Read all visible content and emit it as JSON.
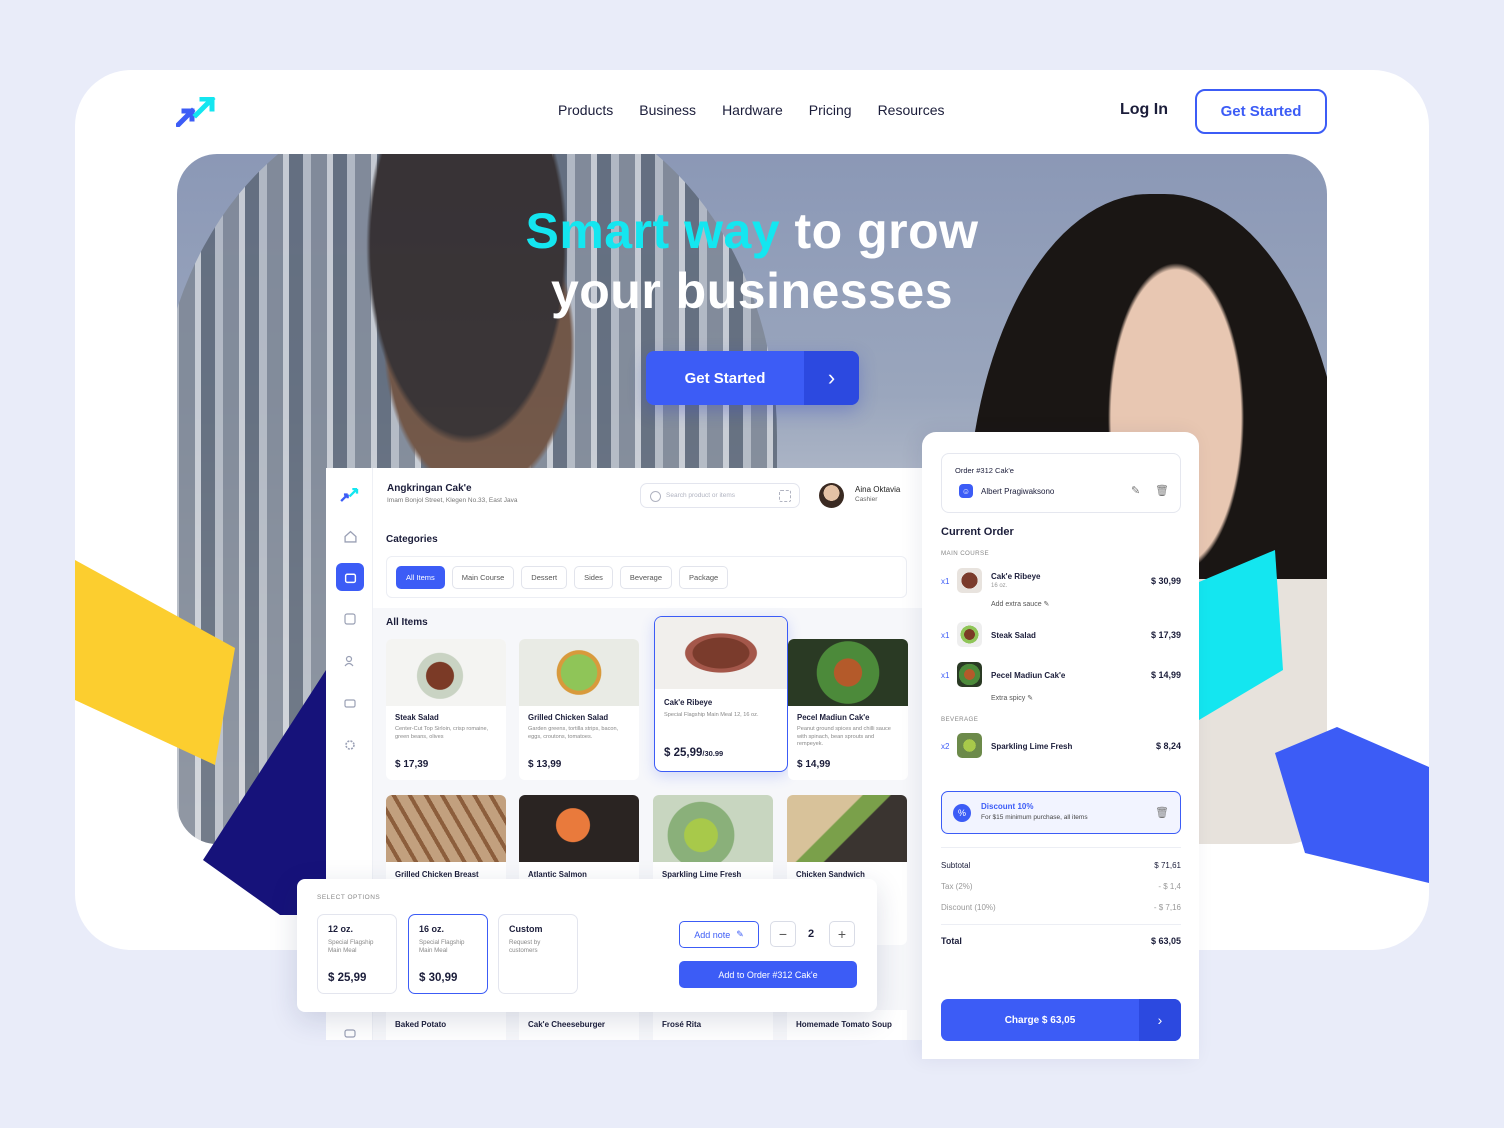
{
  "nav": {
    "links": [
      "Products",
      "Business",
      "Hardware",
      "Pricing",
      "Resources"
    ],
    "login": "Log In",
    "get_started": "Get Started"
  },
  "hero": {
    "accent": "Smart way",
    "line1_rest": " to grow",
    "line2": "your businesses",
    "cta": "Get Started",
    "cta_arrow": "›"
  },
  "colors": {
    "primary": "#3c5cf6",
    "accent": "#14e6f0",
    "yellow": "#fcce2f",
    "navy": "#16127a"
  },
  "pos": {
    "store_name": "Angkringan Cak'e",
    "address": "Imam Bonjol Street, Klegen No.33, East Java",
    "search_placeholder": "Search product or items",
    "user_name": "Aina Oktavia",
    "user_role": "Cashier",
    "categories_title": "Categories",
    "categories": [
      "All Items",
      "Main Course",
      "Dessert",
      "Sides",
      "Beverage",
      "Package"
    ],
    "all_items_title": "All Items",
    "items": [
      {
        "name": "Steak Salad",
        "desc": "Center-Cut Top Sirloin, crisp romaine, green beans, olives",
        "price": "$ 17,39"
      },
      {
        "name": "Grilled Chicken Salad",
        "desc": "Garden greens, tortilla strips, bacon, eggs, croutons, tomatoes.",
        "price": "$ 13,99"
      },
      {
        "name": "Cak'e Ribeye",
        "desc": "Special Flagship Main Meal 12, 16 oz.",
        "price": "$ 25,99",
        "price_alt": "/30.99"
      },
      {
        "name": "Pecel Madiun Cak'e",
        "desc": "Peanut ground spices and chilli sauce with spinach, bean sprouts and rempeyek.",
        "price": "$ 14,99"
      }
    ],
    "items_row2": [
      "Grilled Chicken Breast",
      "Atlantic Salmon",
      "Sparkling Lime Fresh",
      "Chicken Sandwich"
    ],
    "items_row3": [
      "Baked Potato",
      "Cak'e Cheeseburger",
      "Frosé Rita",
      "Homemade Tomato Soup"
    ]
  },
  "options": {
    "label": "SELECT OPTIONS",
    "list": [
      {
        "title": "12 oz.",
        "desc": "Special Flagship Main Meal",
        "price": "$ 25,99"
      },
      {
        "title": "16 oz.",
        "desc": "Special Flagship Main Meal",
        "price": "$ 30,99"
      },
      {
        "title": "Custom",
        "desc": "Request by customers",
        "price": ""
      }
    ],
    "add_note": "Add note",
    "qty": "2",
    "add_to_order": "Add to Order #312 Cak'e"
  },
  "order": {
    "id": "Order #312 Cak'e",
    "customer": "Albert Pragiwaksono",
    "title": "Current Order",
    "main_course_label": "MAIN COURSE",
    "beverage_label": "BEVERAGE",
    "lines": [
      {
        "qty": "x1",
        "name": "Cak'e Ribeye",
        "sub": "16 oz.",
        "price": "$ 30,99",
        "note": "Add extra sauce"
      },
      {
        "qty": "x1",
        "name": "Steak Salad",
        "sub": "",
        "price": "$ 17,39",
        "note": ""
      },
      {
        "qty": "x1",
        "name": "Pecel Madiun Cak'e",
        "sub": "",
        "price": "$ 14,99",
        "note": "Extra spicy"
      },
      {
        "qty": "x2",
        "name": "Sparkling Lime Fresh",
        "sub": "",
        "price": "$ 8,24",
        "note": ""
      }
    ],
    "discount_title": "Discount 10%",
    "discount_desc": "For $15 minimum purchase, all items",
    "subtotal_label": "Subtotal",
    "subtotal": "$ 71,61",
    "tax_label": "Tax (2%)",
    "tax": "- $ 1,4",
    "discount_label": "Discount (10%)",
    "discount": "- $ 7,16",
    "total_label": "Total",
    "total": "$ 63,05",
    "charge": "Charge $ 63,05",
    "charge_arrow": "›"
  }
}
